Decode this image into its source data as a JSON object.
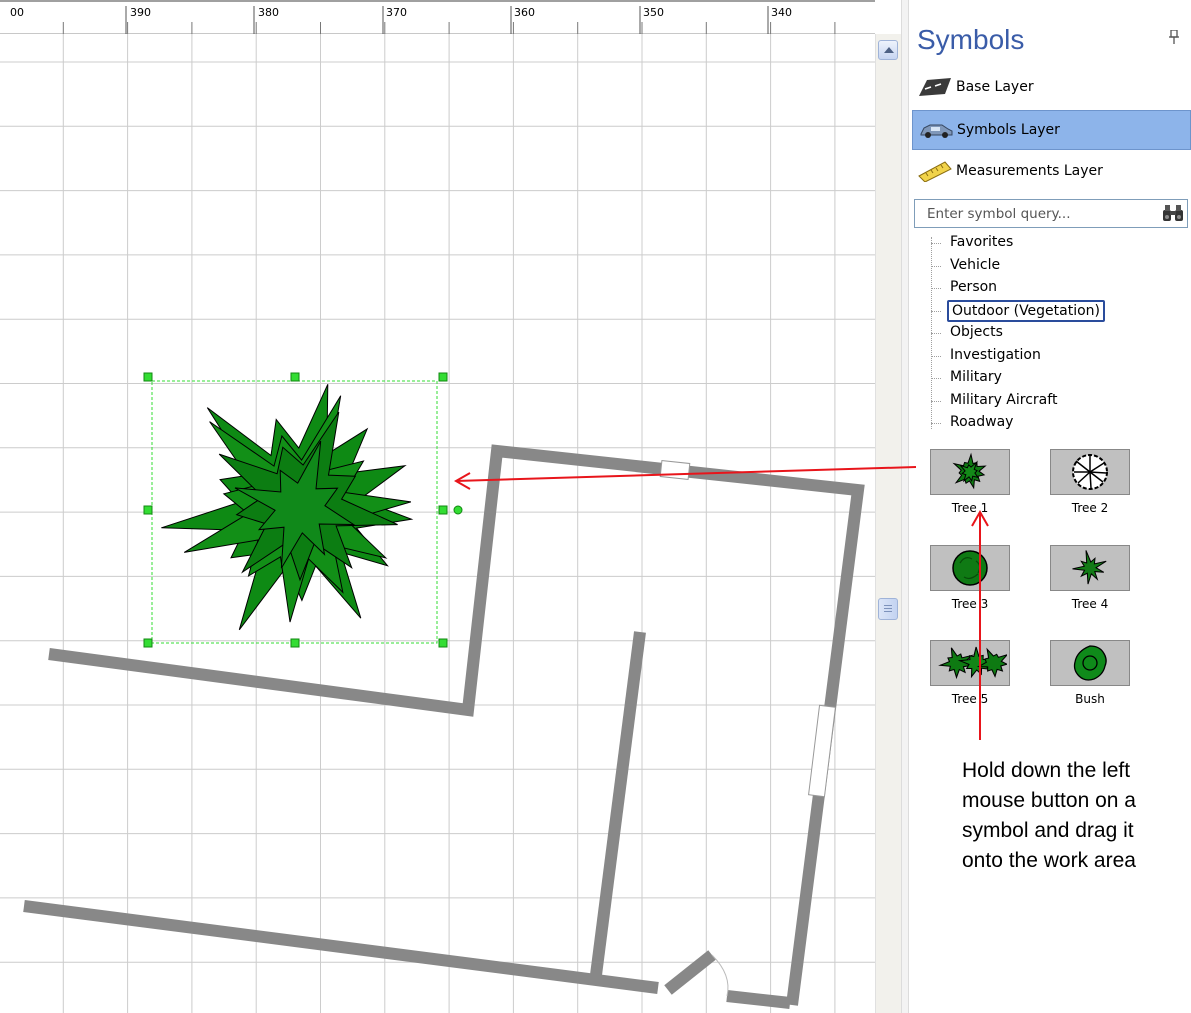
{
  "ruler": {
    "labels": [
      "00",
      "390",
      "380",
      "370",
      "360",
      "350",
      "340"
    ]
  },
  "panel": {
    "title": "Symbols",
    "pin_icon": "pin-icon",
    "layers": [
      {
        "label": "Base Layer",
        "icon": "road-icon",
        "selected": false
      },
      {
        "label": "Symbols Layer",
        "icon": "car-icon",
        "selected": true
      },
      {
        "label": "Measurements Layer",
        "icon": "ruler-icon",
        "selected": false
      }
    ],
    "search": {
      "placeholder": "Enter symbol query...",
      "value": ""
    },
    "categories": [
      "Favorites",
      "Vehicle",
      "Person",
      "Outdoor (Vegetation)",
      "Objects",
      "Investigation",
      "Military",
      "Military Aircraft",
      "Roadway"
    ],
    "selected_category": "Outdoor (Vegetation)",
    "symbols": [
      {
        "label": "Tree 1",
        "icon": "tree-1-icon"
      },
      {
        "label": "Tree 2",
        "icon": "tree-2-icon"
      },
      {
        "label": "Tree 3",
        "icon": "tree-3-icon"
      },
      {
        "label": "Tree 4",
        "icon": "tree-4-icon"
      },
      {
        "label": "Tree 5",
        "icon": "tree-5-icon"
      },
      {
        "label": "Bush",
        "icon": "bush-icon"
      }
    ]
  },
  "annotation": {
    "instruction": "Hold down the left mouse button on a symbol and drag it onto the work area",
    "arrow_color": "#e8151b"
  },
  "colors": {
    "wall": "#888888",
    "grid": "#cccccc",
    "tree_fill": "#0e8a14",
    "selection": "#33dd33",
    "panel_title": "#3a5ca8",
    "selected_layer": "#8db4ea"
  }
}
